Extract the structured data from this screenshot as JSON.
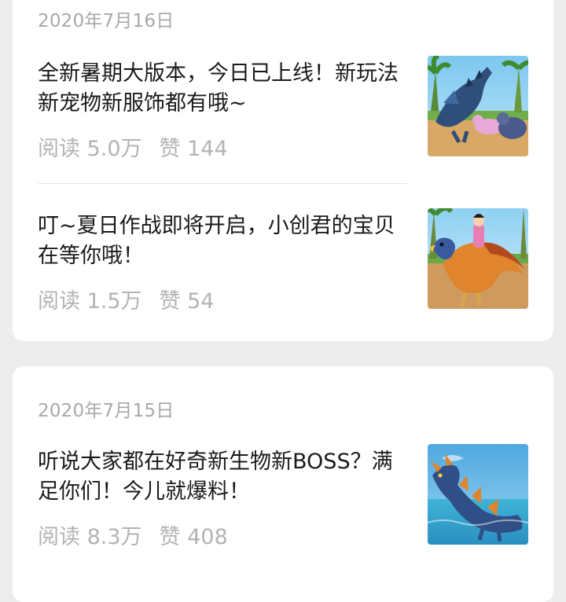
{
  "sections": [
    {
      "date": "2020年7月16日",
      "articles": [
        {
          "title": "全新暑期大版本，今日已上线！新玩法新宠物新服饰都有哦~",
          "reads": "阅读 5.0万",
          "likes": "赞 144",
          "thumbnail": "dragon-and-pets-on-beach"
        },
        {
          "title": "叮~夏日作战即将开启，小创君的宝贝在等你哦！",
          "reads": "阅读 1.5万",
          "likes": "赞 54",
          "thumbnail": "girl-riding-orange-bird"
        }
      ]
    },
    {
      "date": "2020年7月15日",
      "articles": [
        {
          "title": "听说大家都在好奇新生物新BOSS？满足你们！今儿就爆料！",
          "reads": "阅读 8.3万",
          "likes": "赞 408",
          "thumbnail": "sea-dragon-in-water"
        }
      ]
    }
  ],
  "colors": {
    "background": "#ededed",
    "card": "#ffffff",
    "title_text": "#1a1a1a",
    "meta_text": "#b3b3b3",
    "date_text": "#a8a8a8"
  }
}
